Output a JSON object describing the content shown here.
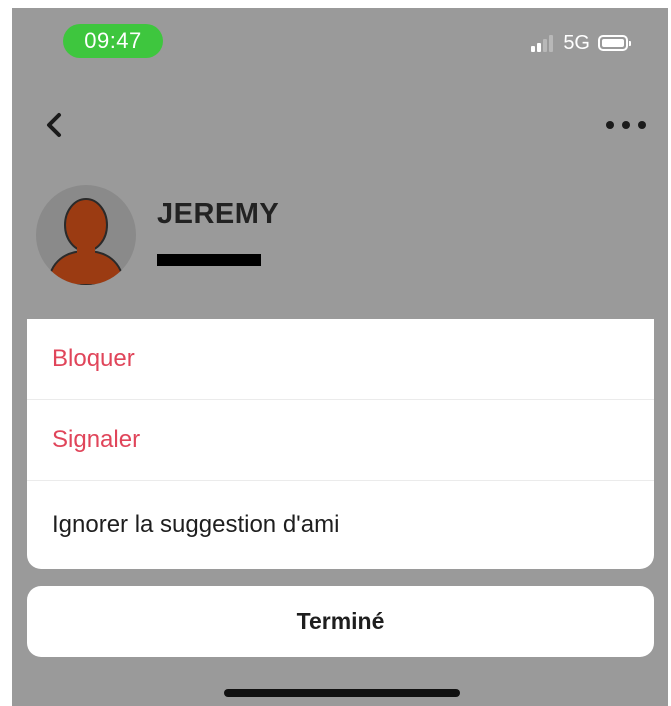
{
  "status_bar": {
    "time": "09:47",
    "network": "5G",
    "signal_bars_active": 2,
    "signal_bars_total": 4,
    "time_pill_color": "#3ec63e"
  },
  "nav": {
    "back_icon": "chevron-left-icon",
    "more_icon": "more-horizontal-icon"
  },
  "profile": {
    "name": "JEREMY",
    "avatar_icon": "default-avatar-icon",
    "username_redacted": true
  },
  "action_sheet": {
    "items": [
      {
        "label": "Bloquer",
        "style": "destructive"
      },
      {
        "label": "Signaler",
        "style": "destructive"
      },
      {
        "label": "Ignorer la suggestion d'ami",
        "style": "default"
      }
    ],
    "done_label": "Terminé"
  },
  "colors": {
    "destructive": "#e0455a",
    "overlay": "#9a9a9a",
    "avatar_skin": "#9b3b12"
  }
}
